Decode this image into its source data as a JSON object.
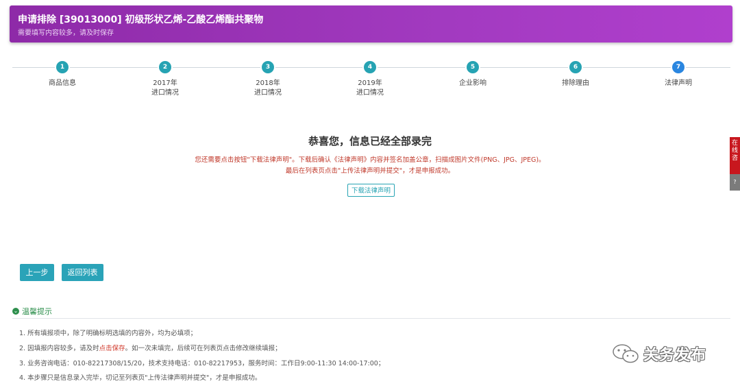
{
  "header": {
    "title": "申请排除 [39013000] 初级形状乙烯-乙酸乙烯酯共聚物",
    "subtitle": "需要填写内容较多，请及时保存"
  },
  "steps": [
    {
      "num": "1",
      "label": "商品信息"
    },
    {
      "num": "2",
      "label": "2017年\n进口情况"
    },
    {
      "num": "3",
      "label": "2018年\n进口情况"
    },
    {
      "num": "4",
      "label": "2019年\n进口情况"
    },
    {
      "num": "5",
      "label": "企业影响"
    },
    {
      "num": "6",
      "label": "排除理由"
    },
    {
      "num": "7",
      "label": "法律声明"
    }
  ],
  "completion": {
    "title": "恭喜您，信息已经全部录完",
    "note_line1": "您还需要点击按钮\"下载法律声明\"。下载后确认《法律声明》内容并签名加盖公章，扫描成图片文件(PNG、JPG、JPEG)。",
    "note_line2": "最后在列表页点击\"上传法律声明并提交\"，才是申报成功。",
    "download_label": "下载法律声明"
  },
  "actions": {
    "prev_label": "上一步",
    "back_label": "返回列表"
  },
  "tips": {
    "heading": "温馨提示",
    "line1": "1. 所有填报项中，除了明确标明选填的内容外，均为必填项；",
    "line2_a": "2. 因填报内容较多，请及时",
    "line2_hl": "点击保存",
    "line2_b": "。如一次未填完，后续可在列表页点击修改继续填报；",
    "line3": "3. 业务咨询电话：010-82217308/15/20，技术支持电话：010-82217953，服务时间：工作日9:00-11:30 14:00-17:00；",
    "line4": "4. 本步骤只是信息录入完毕，切记至列表页\"上传法律声明并提交\"，才是申报成功。"
  },
  "float_tab": {
    "label": "在线咨",
    "secondary": "?"
  },
  "watermark": {
    "text": "关务发布",
    "icon": "wechat-icon"
  },
  "colors": {
    "header": "#9b35bb",
    "step": "#26a3b3",
    "step_active": "#2a86e0",
    "button": "#2aa3b8",
    "note": "#c0392b",
    "tips_heading": "#2e8f4d"
  }
}
